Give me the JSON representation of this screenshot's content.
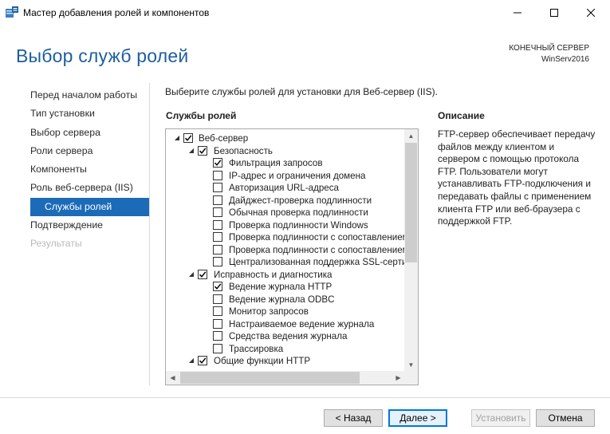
{
  "window": {
    "title": "Мастер добавления ролей и компонентов"
  },
  "header": {
    "page_title": "Выбор служб ролей",
    "server_label": "КОНЕЧНЫЙ СЕРВЕР",
    "server_name": "WinServ2016"
  },
  "nav": {
    "items": [
      {
        "label": "Перед началом работы",
        "state": "normal"
      },
      {
        "label": "Тип установки",
        "state": "normal"
      },
      {
        "label": "Выбор сервера",
        "state": "normal"
      },
      {
        "label": "Роли сервера",
        "state": "normal"
      },
      {
        "label": "Компоненты",
        "state": "normal"
      },
      {
        "label": "Роль веб-сервера (IIS)",
        "state": "normal"
      },
      {
        "label": "Службы ролей",
        "state": "selected"
      },
      {
        "label": "Подтверждение",
        "state": "normal"
      },
      {
        "label": "Результаты",
        "state": "disabled"
      }
    ]
  },
  "main": {
    "instruction": "Выберите службы ролей для установки для Веб-сервер (IIS).",
    "roles_heading": "Службы ролей",
    "description_heading": "Описание",
    "description": "FTP-сервер обеспечивает передачу файлов между клиентом и сервером с помощью протокола FTP. Пользователи могут устанавливать FTP-подключения и передавать файлы с применением клиента FTP или веб-браузера с поддержкой FTP."
  },
  "tree": [
    {
      "label": "Веб-сервер",
      "level": 0,
      "expander": true,
      "checked": true
    },
    {
      "label": "Безопасность",
      "level": 1,
      "expander": true,
      "checked": true
    },
    {
      "label": "Фильтрация запросов",
      "level": 2,
      "expander": false,
      "checked": true
    },
    {
      "label": "IP-адрес и ограничения домена",
      "level": 2,
      "expander": false,
      "checked": false
    },
    {
      "label": "Авторизация URL-адреса",
      "level": 2,
      "expander": false,
      "checked": false
    },
    {
      "label": "Дайджест-проверка подлинности",
      "level": 2,
      "expander": false,
      "checked": false
    },
    {
      "label": "Обычная проверка подлинности",
      "level": 2,
      "expander": false,
      "checked": false
    },
    {
      "label": "Проверка подлинности Windows",
      "level": 2,
      "expander": false,
      "checked": false
    },
    {
      "label": "Проверка подлинности с сопоставлением",
      "level": 2,
      "expander": false,
      "checked": false
    },
    {
      "label": "Проверка подлинности с сопоставлением",
      "level": 2,
      "expander": false,
      "checked": false
    },
    {
      "label": "Централизованная поддержка SSL-серти",
      "level": 2,
      "expander": false,
      "checked": false
    },
    {
      "label": "Исправность и диагностика",
      "level": 1,
      "expander": true,
      "checked": true
    },
    {
      "label": "Ведение журнала HTTP",
      "level": 2,
      "expander": false,
      "checked": true
    },
    {
      "label": "Ведение журнала ODBC",
      "level": 2,
      "expander": false,
      "checked": false
    },
    {
      "label": "Монитор запросов",
      "level": 2,
      "expander": false,
      "checked": false
    },
    {
      "label": "Настраиваемое ведение журнала",
      "level": 2,
      "expander": false,
      "checked": false
    },
    {
      "label": "Средства ведения журнала",
      "level": 2,
      "expander": false,
      "checked": false
    },
    {
      "label": "Трассировка",
      "level": 2,
      "expander": false,
      "checked": false
    },
    {
      "label": "Общие функции HTTP",
      "level": 1,
      "expander": true,
      "checked": true
    }
  ],
  "footer": {
    "back_label": "< Назад",
    "next_label": "Далее >",
    "install_label": "Установить",
    "cancel_label": "Отмена"
  },
  "colors": {
    "accent": "#1c6bb8",
    "title_blue": "#1c5f9f",
    "disabled_text": "#b9b9b9"
  },
  "icons": {
    "app": "server-manager-icon",
    "minimize": "minimize-icon",
    "maximize": "maximize-icon",
    "close": "close-icon",
    "check": "checkmark-icon",
    "expand": "triangle-expand-icon"
  }
}
